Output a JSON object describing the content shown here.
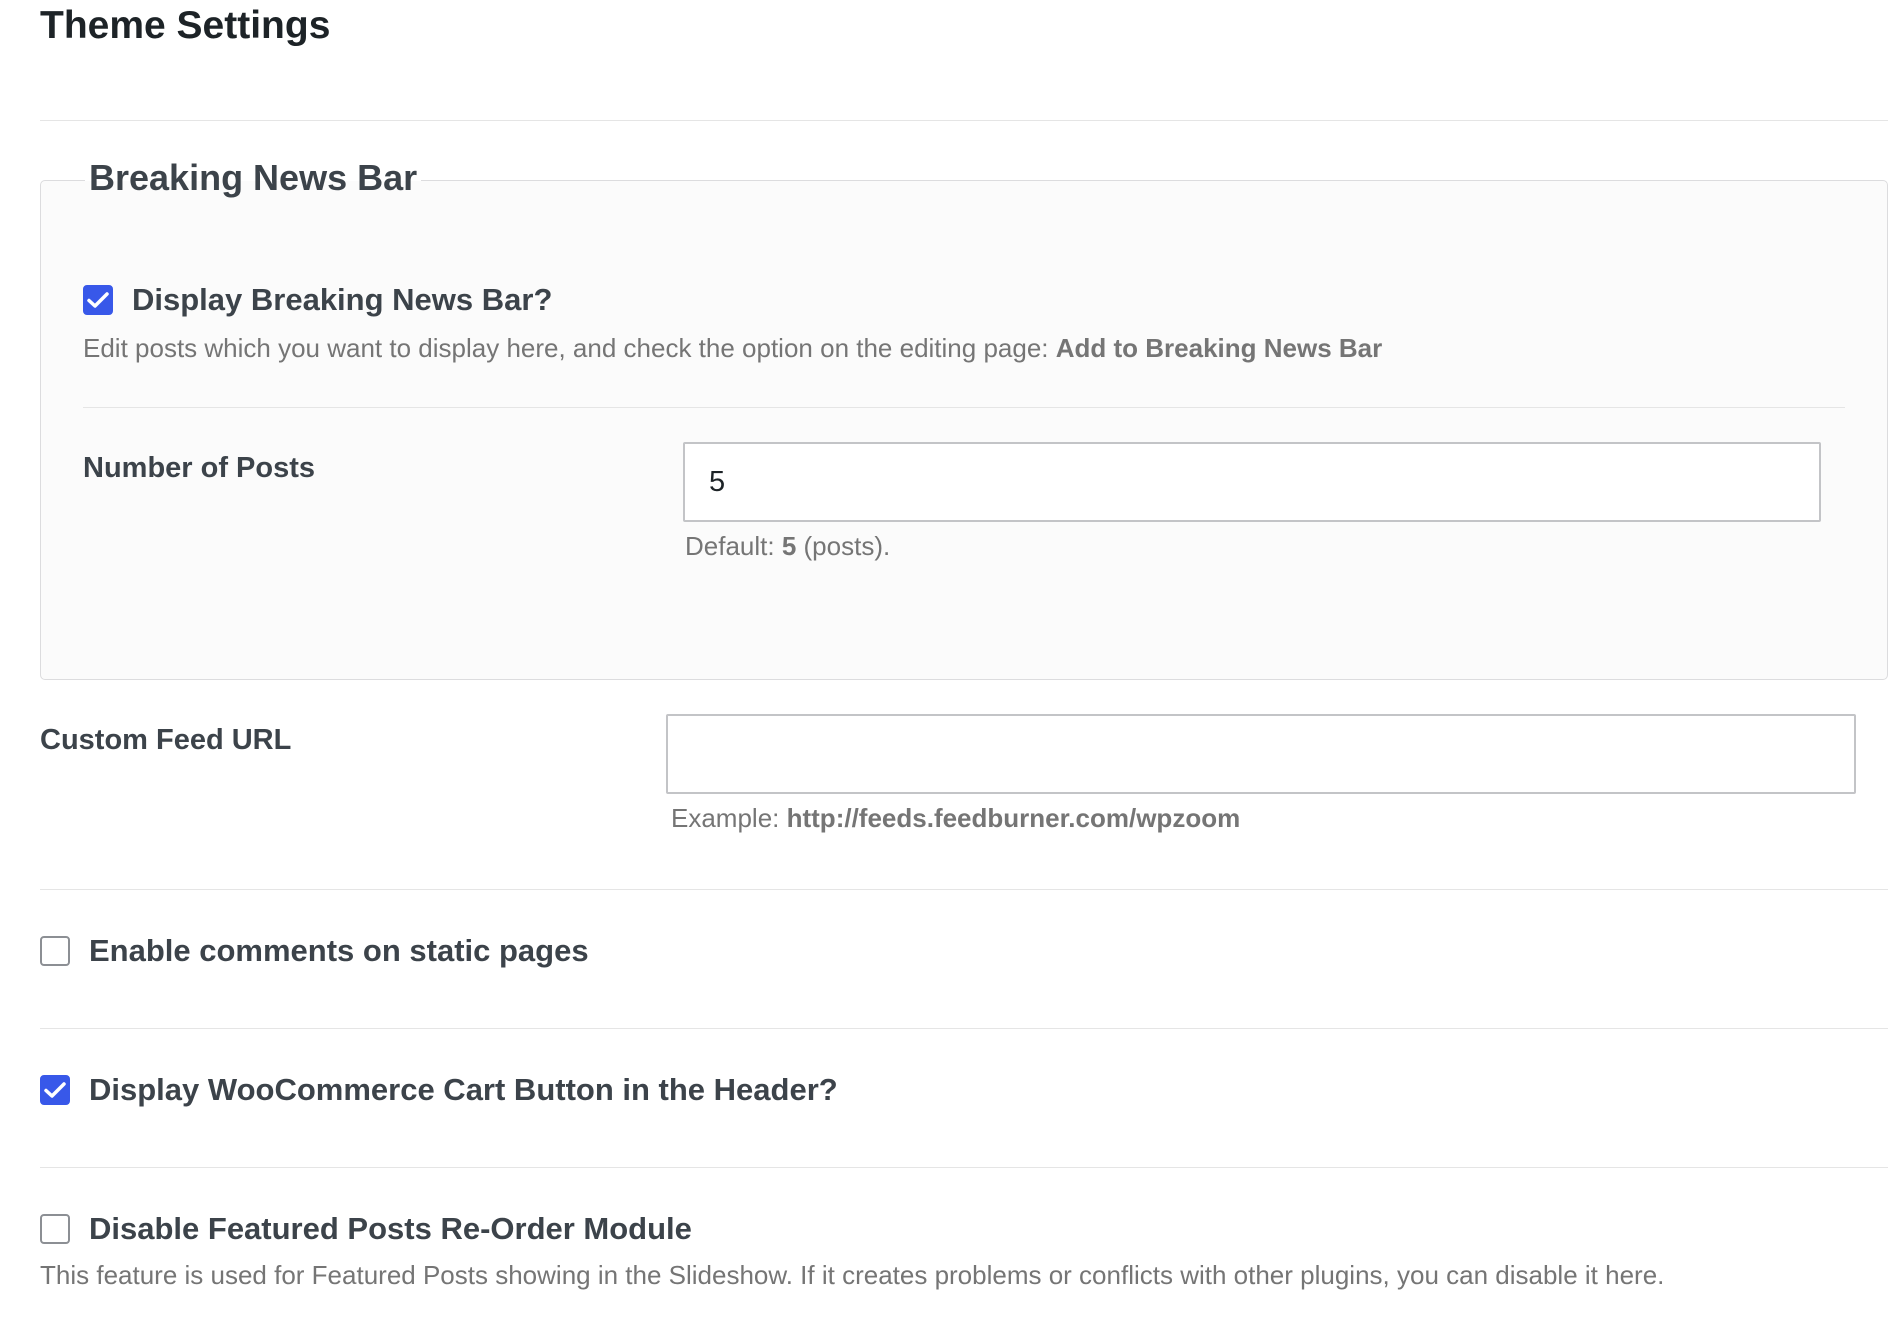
{
  "page_title": "Theme Settings",
  "breaking_news": {
    "legend": "Breaking News Bar",
    "display_label": "Display Breaking News Bar?",
    "display_checked": true,
    "desc_text": "Edit posts which you want to display here, and check the option on the editing page: ",
    "desc_bold": "Add to Breaking News Bar",
    "num_posts_label": "Number of Posts",
    "num_posts_value": "5",
    "num_posts_hint_prefix": "Default: ",
    "num_posts_hint_bold": "5",
    "num_posts_hint_suffix": " (posts)."
  },
  "custom_feed": {
    "label": "Custom Feed URL",
    "value": "",
    "hint_prefix": "Example: ",
    "hint_bold": "http://feeds.feedburner.com/wpzoom"
  },
  "comments_static": {
    "label": "Enable comments on static pages",
    "checked": false
  },
  "woo_cart": {
    "label": "Display WooCommerce Cart Button in the Header?",
    "checked": true
  },
  "disable_reorder": {
    "label": "Disable Featured Posts Re-Order Module",
    "checked": false,
    "desc": "This feature is used for Featured Posts showing in the Slideshow. If it creates problems or conflicts with other plugins, you can disable it here."
  },
  "colors": {
    "checkbox_accent": "#3858e9",
    "text": "#3c434a",
    "muted": "#757575"
  }
}
